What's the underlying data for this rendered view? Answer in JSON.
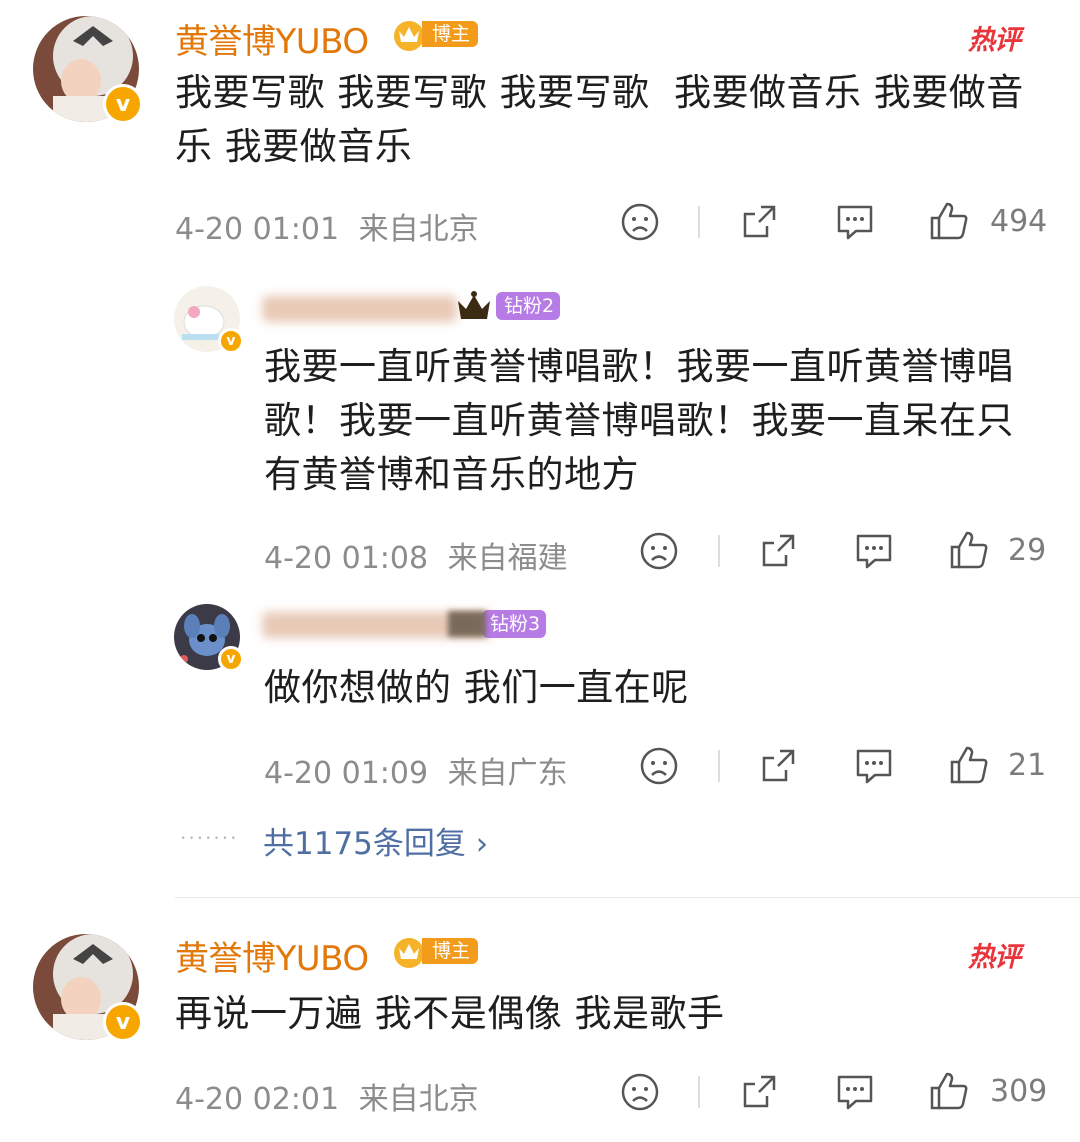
{
  "comments": [
    {
      "author": "黄誉博YUBO",
      "badge": "博主",
      "hot_label": "热评",
      "text": "我要写歌 我要写歌 我要写歌  我要做音乐 我要做音乐 我要做音乐",
      "time": "4-20 01:01",
      "location": "来自北京",
      "likes": "494"
    },
    {
      "author": "黄誉博YUBO",
      "badge": "博主",
      "hot_label": "热评",
      "text": "再说一万遍 我不是偶像 我是歌手",
      "time": "4-20 02:01",
      "location": "来自北京",
      "likes": "309"
    }
  ],
  "replies": [
    {
      "fan_badge": "钻粉2",
      "text": "我要一直听黄誉博唱歌！我要一直听黄誉博唱歌！我要一直听黄誉博唱歌！我要一直呆在只有黄誉博和音乐的地方",
      "time": "4-20 01:08",
      "location": "来自福建",
      "likes": "29"
    },
    {
      "fan_badge": "钻粉3",
      "text": "做你想做的 我们一直在呢",
      "time": "4-20 01:09",
      "location": "来自广东",
      "likes": "21"
    }
  ],
  "reply_summary": "共1175条回复 ›",
  "colors": {
    "author": "#e2780a",
    "hot": "#e8343b",
    "link": "#4f6fa3",
    "meta": "#8c8c8c"
  },
  "icons": [
    "dislike-face-icon",
    "share-icon",
    "comment-icon",
    "thumbs-up-icon",
    "chevron-right-icon"
  ]
}
